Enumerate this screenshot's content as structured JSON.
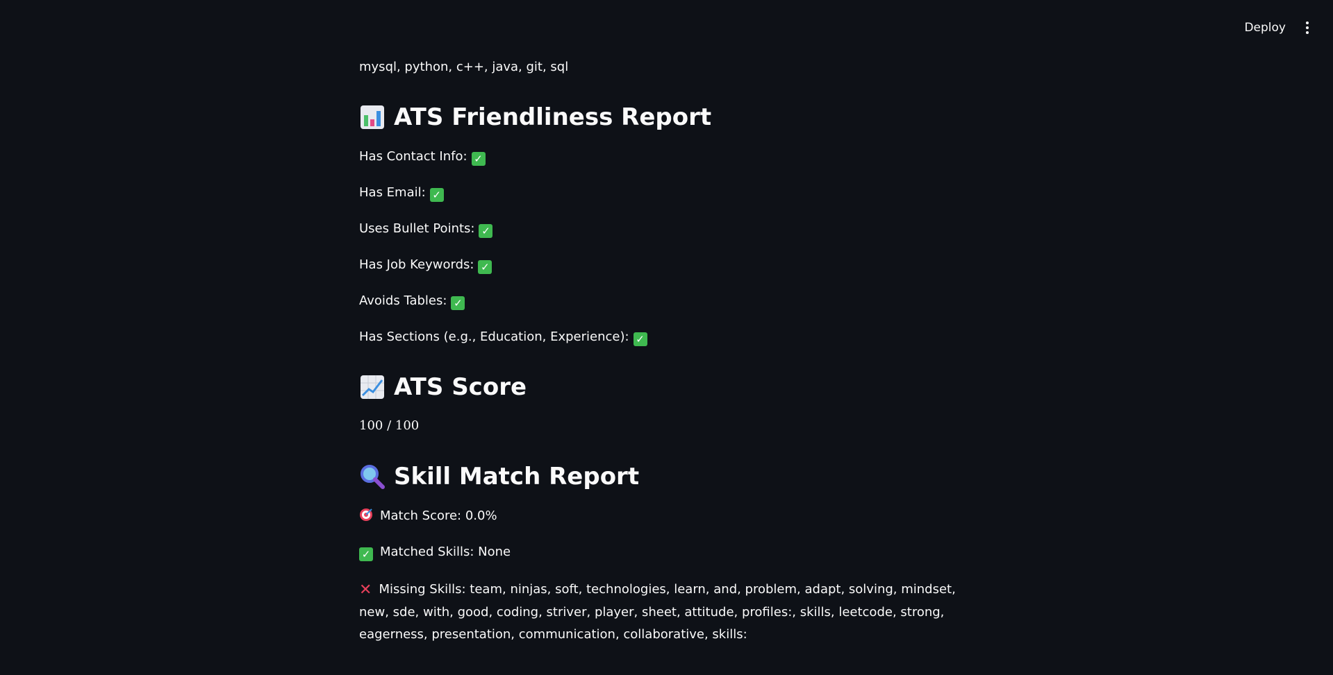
{
  "toolbar": {
    "deploy_label": "Deploy",
    "menu_icon": "more-vertical-icon"
  },
  "skills_line": "mysql, python, c++, java, git, sql",
  "ats_report": {
    "title": "ATS Friendliness Report",
    "icon": "bar-chart-icon",
    "items": [
      {
        "label": "Has Contact Info:",
        "status": "check"
      },
      {
        "label": "Has Email:",
        "status": "check"
      },
      {
        "label": "Uses Bullet Points:",
        "status": "check"
      },
      {
        "label": "Has Job Keywords:",
        "status": "check"
      },
      {
        "label": "Avoids Tables:",
        "status": "check"
      },
      {
        "label": "Has Sections (e.g., Education, Experience):",
        "status": "check"
      }
    ]
  },
  "ats_score": {
    "title": "ATS Score",
    "icon": "trending-up-chart-icon",
    "value": "100 / 100"
  },
  "skill_match": {
    "title": "Skill Match Report",
    "icon": "magnifier-icon",
    "match_score": "Match Score: 0.0%",
    "matched_skills": "Matched Skills: None",
    "missing_skills": "Missing Skills: team, ninjas, soft, technologies, learn, and, problem, adapt, solving, mindset, new, sde, with, good, coding, striver, player, sheet, attitude, profiles:, skills, leetcode, strong, eagerness, presentation, communication, collaborative, skills:"
  },
  "colors": {
    "background": "#0e1117",
    "text": "#fafafa",
    "check_green": "#3fb950",
    "cross_red": "#e8405b"
  }
}
